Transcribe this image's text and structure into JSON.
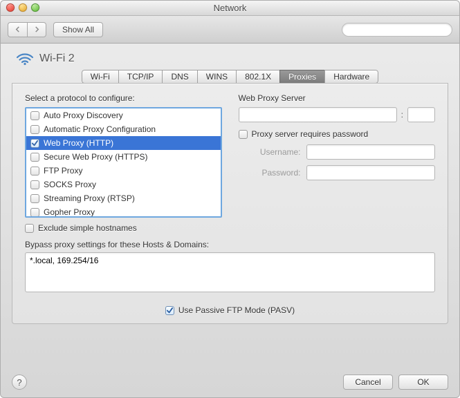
{
  "window": {
    "title": "Network"
  },
  "toolbar": {
    "show_all_label": "Show All",
    "search_placeholder": ""
  },
  "header": {
    "interface_name": "Wi-Fi 2"
  },
  "tabs": [
    {
      "label": "Wi-Fi"
    },
    {
      "label": "TCP/IP"
    },
    {
      "label": "DNS"
    },
    {
      "label": "WINS"
    },
    {
      "label": "802.1X"
    },
    {
      "label": "Proxies"
    },
    {
      "label": "Hardware"
    }
  ],
  "selected_tab_index": 5,
  "proxies": {
    "select_label": "Select a protocol to configure:",
    "protocols": [
      {
        "label": "Auto Proxy Discovery",
        "checked": false
      },
      {
        "label": "Automatic Proxy Configuration",
        "checked": false
      },
      {
        "label": "Web Proxy (HTTP)",
        "checked": true
      },
      {
        "label": "Secure Web Proxy (HTTPS)",
        "checked": false
      },
      {
        "label": "FTP Proxy",
        "checked": false
      },
      {
        "label": "SOCKS Proxy",
        "checked": false
      },
      {
        "label": "Streaming Proxy (RTSP)",
        "checked": false
      },
      {
        "label": "Gopher Proxy",
        "checked": false
      }
    ],
    "selected_protocol_index": 2,
    "exclude_simple_label": "Exclude simple hostnames",
    "exclude_simple_checked": false,
    "server_label": "Web Proxy Server",
    "server_host": "",
    "server_port": "",
    "requires_password_label": "Proxy server requires password",
    "requires_password_checked": false,
    "username_label": "Username:",
    "username_value": "",
    "password_label": "Password:",
    "password_value": "",
    "bypass_label": "Bypass proxy settings for these Hosts & Domains:",
    "bypass_value": "*.local, 169.254/16",
    "pasv_label": "Use Passive FTP Mode (PASV)",
    "pasv_checked": true
  },
  "buttons": {
    "cancel": "Cancel",
    "ok": "OK"
  },
  "help_glyph": "?"
}
